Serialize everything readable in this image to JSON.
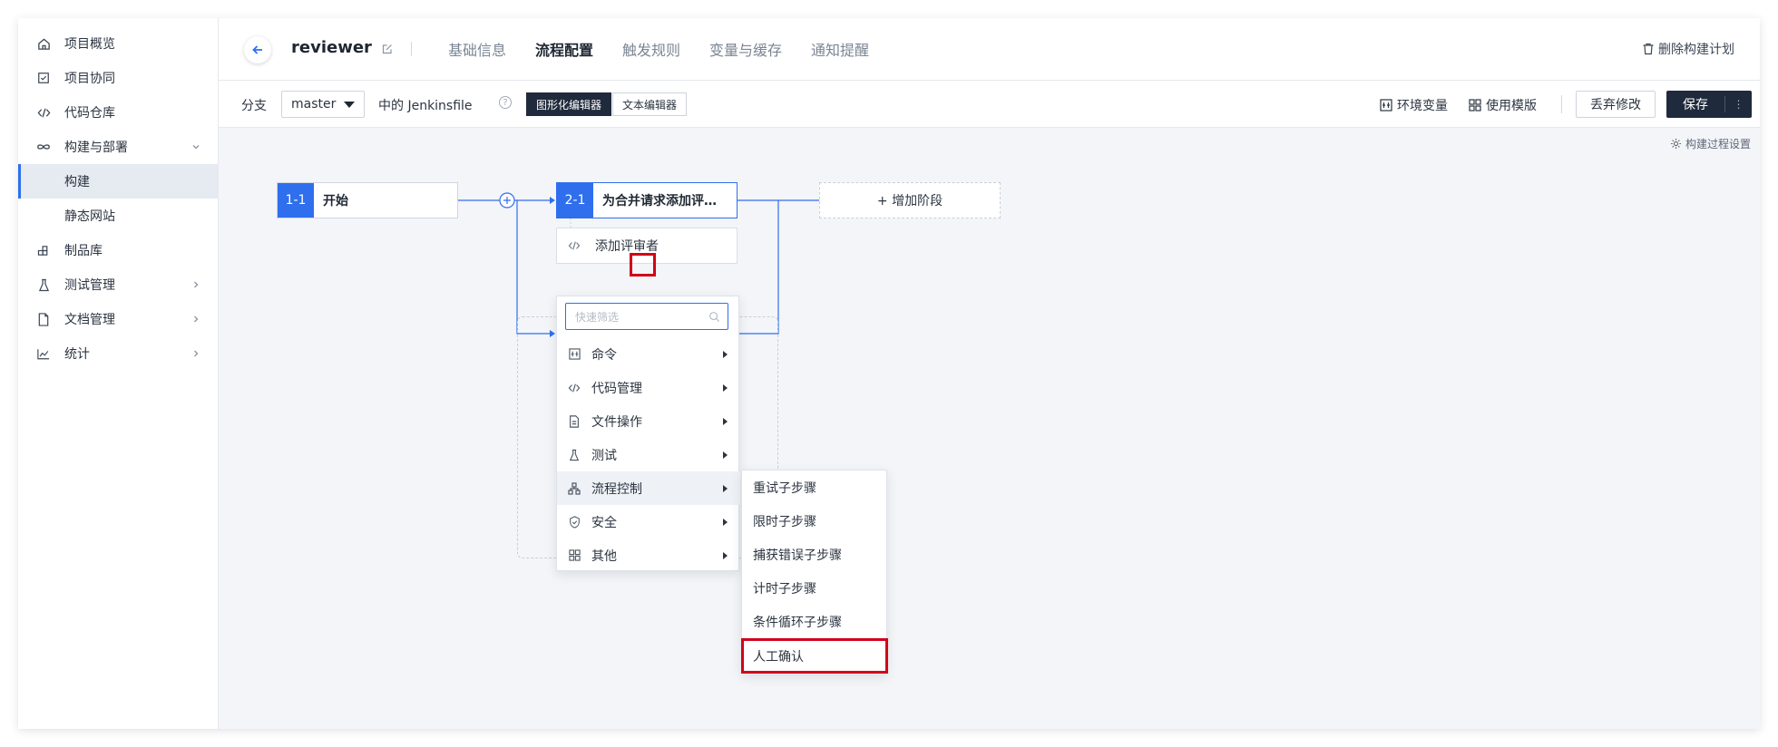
{
  "sidebar": {
    "items": [
      {
        "label": "项目概览",
        "icon": "home-icon"
      },
      {
        "label": "项目协同",
        "icon": "checkbox-icon"
      },
      {
        "label": "代码仓库",
        "icon": "code-icon"
      },
      {
        "label": "构建与部署",
        "icon": "infinity-icon"
      },
      {
        "label": "构建",
        "icon": ""
      },
      {
        "label": "静态网站",
        "icon": ""
      },
      {
        "label": "制品库",
        "icon": "package-icon"
      },
      {
        "label": "测试管理",
        "icon": "flask-icon"
      },
      {
        "label": "文档管理",
        "icon": "document-icon"
      },
      {
        "label": "统计",
        "icon": "chart-line-icon"
      }
    ]
  },
  "header": {
    "project_name": "reviewer",
    "tabs": [
      "基础信息",
      "流程配置",
      "触发规则",
      "变量与缓存",
      "通知提醒"
    ],
    "active_tab": "流程配置",
    "delete_label": "删除构建计划"
  },
  "toolbar": {
    "branch_label": "分支",
    "branch_value": "master",
    "jenkins_label": "中的 Jenkinsfile",
    "help_glyph": "?",
    "graphic_editor": "图形化编辑器",
    "text_editor": "文本编辑器",
    "env_vars": "环境变量",
    "use_template": "使用模版",
    "discard": "丢弃修改",
    "save": "保存",
    "more_glyph": "⋮"
  },
  "canvas": {
    "process_settings": "构建过程设置",
    "stage1": {
      "num": "1-1",
      "name": "开始"
    },
    "stage2": {
      "num": "2-1",
      "name": "为合并请求添加评…"
    },
    "add_stage": "+ 增加阶段",
    "step_name": "添加评审者"
  },
  "dropdown": {
    "filter_placeholder": "快速筛选",
    "items": [
      {
        "label": "命令",
        "icon": "terminal-icon"
      },
      {
        "label": "代码管理",
        "icon": "code-icon"
      },
      {
        "label": "文件操作",
        "icon": "file-icon"
      },
      {
        "label": "测试",
        "icon": "flask-icon"
      },
      {
        "label": "流程控制",
        "icon": "flow-control-icon"
      },
      {
        "label": "安全",
        "icon": "shield-icon"
      },
      {
        "label": "其他",
        "icon": "grid-icon"
      }
    ],
    "hovered": "流程控制"
  },
  "submenu": {
    "items": [
      "重试子步骤",
      "限时子步骤",
      "捕获错误子步骤",
      "计时子步骤",
      "条件循环子步骤",
      "人工确认"
    ],
    "highlighted": "人工确认"
  },
  "colors": {
    "accent": "#2f6fed",
    "highlight": "#d0021b",
    "dark_button": "#1f2a3c",
    "canvas_bg": "#f3f5f9"
  }
}
